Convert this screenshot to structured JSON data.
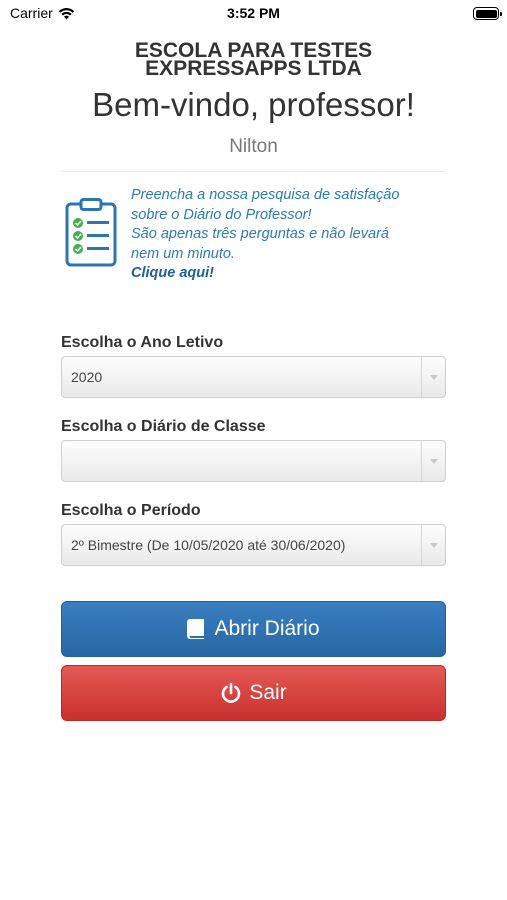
{
  "status_bar": {
    "carrier": "Carrier",
    "time": "3:52 PM"
  },
  "header": {
    "school_line1": "ESCOLA PARA TESTES",
    "school_line2": "EXPRESSAPPS LTDA",
    "welcome": "Bem-vindo, professor!",
    "teacher_name": "Nilton"
  },
  "survey": {
    "icon": "clipboard-checklist-icon",
    "lines": [
      "Preencha a nossa pesquisa de satisfação",
      "sobre o Diário do Professor!",
      "São apenas três perguntas e não levará",
      "nem um minuto."
    ],
    "link": "Clique aqui!"
  },
  "form": {
    "year": {
      "label": "Escolha o Ano Letivo",
      "value": "2020"
    },
    "diary": {
      "label": "Escolha o Diário de Classe",
      "value": ""
    },
    "period": {
      "label": "Escolha o Período",
      "value": "2º Bimestre (De 10/05/2020 até 30/06/2020)"
    }
  },
  "buttons": {
    "open": {
      "label": "Abrir Diário",
      "icon": "book-icon",
      "color": "#2e70b0"
    },
    "exit": {
      "label": "Sair",
      "icon": "power-icon",
      "color": "#d9413d"
    }
  }
}
